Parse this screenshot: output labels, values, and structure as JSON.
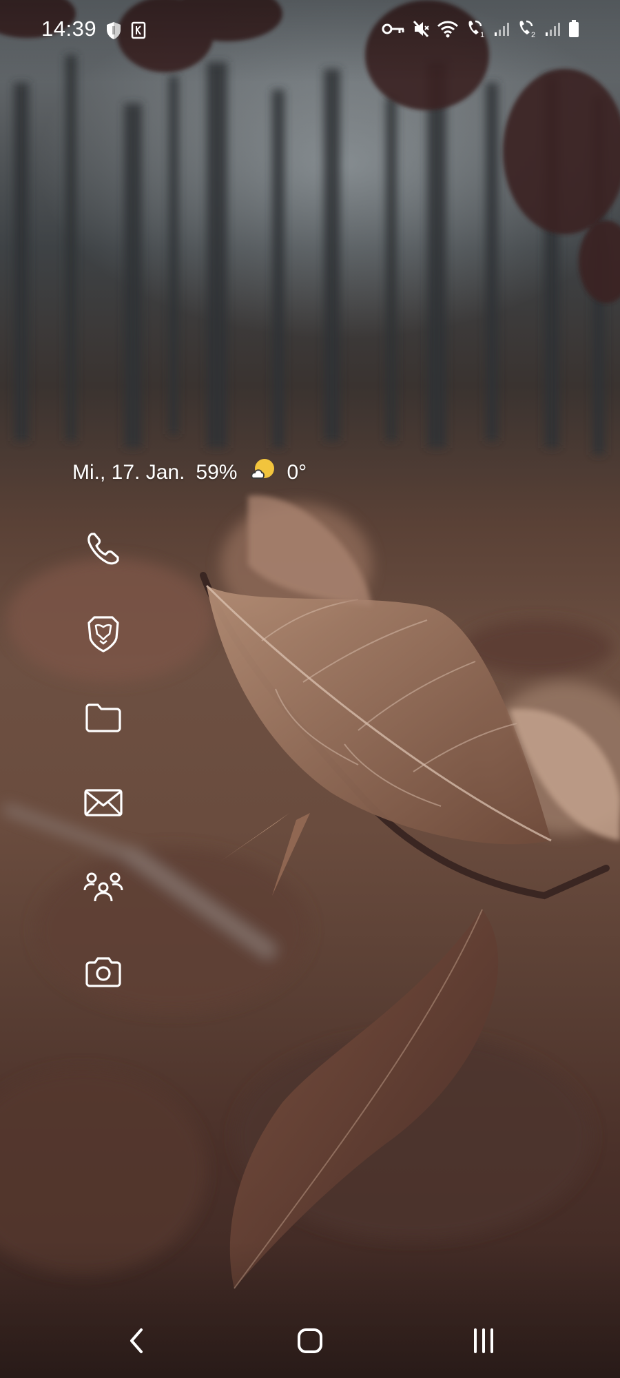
{
  "status_bar": {
    "time": "14:39",
    "left_icons": [
      "shield-icon",
      "k-badge-icon"
    ],
    "right_icons": [
      "vpn-key-icon",
      "mute-icon",
      "wifi-icon",
      "call-sim1-icon",
      "signal-icon",
      "call-sim2-icon",
      "signal-icon",
      "battery-icon"
    ],
    "sim1_label": "1",
    "sim2_label": "2"
  },
  "widget": {
    "date": "Mi., 17. Jan.",
    "battery": "59%",
    "weather_icon": "partly-cloudy-icon",
    "temperature": "0°",
    "sun_color": "#f2c43d"
  },
  "apps": [
    {
      "name": "phone",
      "icon": "phone-icon"
    },
    {
      "name": "brave-browser",
      "icon": "lion-icon"
    },
    {
      "name": "files",
      "icon": "folder-icon"
    },
    {
      "name": "mail",
      "icon": "mail-icon"
    },
    {
      "name": "contacts",
      "icon": "group-icon"
    },
    {
      "name": "camera",
      "icon": "camera-icon"
    }
  ],
  "nav": {
    "back": "chevron-left-icon",
    "home": "home-icon",
    "recents": "recents-icon"
  },
  "colors": {
    "icon": "#ffffff",
    "text": "#ffffff"
  }
}
